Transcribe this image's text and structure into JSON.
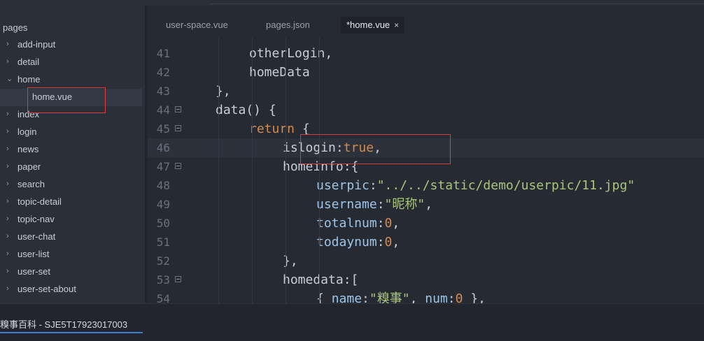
{
  "sidebar": {
    "root_label": "pages",
    "items": [
      {
        "label": "add-input",
        "expanded": false
      },
      {
        "label": "detail",
        "expanded": false
      },
      {
        "label": "home",
        "expanded": true
      },
      {
        "label": "home.vue",
        "file": true
      },
      {
        "label": "index",
        "expanded": false
      },
      {
        "label": "login",
        "expanded": false
      },
      {
        "label": "news",
        "expanded": false
      },
      {
        "label": "paper",
        "expanded": false
      },
      {
        "label": "search",
        "expanded": false
      },
      {
        "label": "topic-detail",
        "expanded": false
      },
      {
        "label": "topic-nav",
        "expanded": false
      },
      {
        "label": "user-chat",
        "expanded": false
      },
      {
        "label": "user-list",
        "expanded": false
      },
      {
        "label": "user-set",
        "expanded": false
      },
      {
        "label": "user-set-about",
        "expanded": false
      }
    ]
  },
  "tabs": [
    {
      "label": "user-space.vue",
      "active": false
    },
    {
      "label": "pages.json",
      "active": false
    },
    {
      "label": "*home.vue",
      "active": true,
      "close": "×"
    }
  ],
  "editor": {
    "current_line": "46",
    "lines": [
      {
        "num": "41",
        "fold": false,
        "tokens": [
          {
            "t": "otherLogin,",
            "c": "p"
          }
        ]
      },
      {
        "num": "42",
        "fold": false,
        "tokens": [
          {
            "t": "homeData",
            "c": "p"
          }
        ]
      },
      {
        "num": "43",
        "fold": false,
        "tokens": [
          {
            "t": "},",
            "c": "p"
          }
        ]
      },
      {
        "num": "44",
        "fold": true,
        "tokens": [
          {
            "t": "data() {",
            "c": "p"
          }
        ]
      },
      {
        "num": "45",
        "fold": true,
        "tokens": [
          {
            "t": "return",
            "c": "k"
          },
          {
            "t": " {",
            "c": "p"
          }
        ]
      },
      {
        "num": "46",
        "fold": false,
        "tokens": [
          {
            "t": "islogin",
            "c": "p"
          },
          {
            "t": ":",
            "c": "p"
          },
          {
            "t": "true",
            "c": "k"
          },
          {
            "t": ",",
            "c": "p"
          }
        ]
      },
      {
        "num": "47",
        "fold": true,
        "tokens": [
          {
            "t": "homeinfo",
            "c": "p"
          },
          {
            "t": ":{",
            "c": "p"
          }
        ]
      },
      {
        "num": "48",
        "fold": false,
        "tokens": [
          {
            "t": "userpic",
            "c": "pr"
          },
          {
            "t": ":",
            "c": "p"
          },
          {
            "t": "\"../../static/demo/userpic/11.jpg\"",
            "c": "s"
          }
        ]
      },
      {
        "num": "49",
        "fold": false,
        "tokens": [
          {
            "t": "username",
            "c": "pr"
          },
          {
            "t": ":",
            "c": "p"
          },
          {
            "t": "\"昵称\"",
            "c": "s"
          },
          {
            "t": ",",
            "c": "p"
          }
        ]
      },
      {
        "num": "50",
        "fold": false,
        "tokens": [
          {
            "t": "totalnum",
            "c": "pr"
          },
          {
            "t": ":",
            "c": "p"
          },
          {
            "t": "0",
            "c": "n"
          },
          {
            "t": ",",
            "c": "p"
          }
        ]
      },
      {
        "num": "51",
        "fold": false,
        "tokens": [
          {
            "t": "todaynum",
            "c": "pr"
          },
          {
            "t": ":",
            "c": "p"
          },
          {
            "t": "0",
            "c": "n"
          },
          {
            "t": ",",
            "c": "p"
          }
        ]
      },
      {
        "num": "52",
        "fold": false,
        "tokens": [
          {
            "t": "},",
            "c": "p"
          }
        ]
      },
      {
        "num": "53",
        "fold": true,
        "tokens": [
          {
            "t": "homedata",
            "c": "p"
          },
          {
            "t": ":[",
            "c": "p"
          }
        ]
      },
      {
        "num": "54",
        "fold": false,
        "tokens": [
          {
            "t": "{ ",
            "c": "p"
          },
          {
            "t": "name",
            "c": "pr"
          },
          {
            "t": ":",
            "c": "p"
          },
          {
            "t": "\"糗事\"",
            "c": "s"
          },
          {
            "t": ", ",
            "c": "p"
          },
          {
            "t": "num",
            "c": "pr"
          },
          {
            "t": ":",
            "c": "p"
          },
          {
            "t": "0",
            "c": "n"
          },
          {
            "t": " },",
            "c": "p"
          }
        ]
      }
    ]
  },
  "status": {
    "window_title": "糗事百科 - SJE5T17923017003"
  },
  "colors": {
    "highlight_border": "#e03a3a",
    "keyword": "#d48b4f",
    "string": "#a8c77a",
    "property": "#9fc4e8",
    "accent": "#3d7bd6"
  }
}
